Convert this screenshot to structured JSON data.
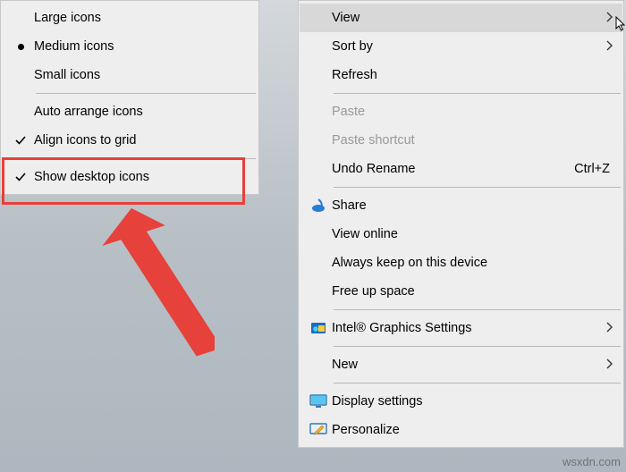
{
  "left_menu": {
    "items": [
      {
        "label": "Large icons",
        "marker": ""
      },
      {
        "label": "Medium icons",
        "marker": "bullet"
      },
      {
        "label": "Small icons",
        "marker": ""
      }
    ],
    "arrange": [
      {
        "label": "Auto arrange icons",
        "marker": ""
      },
      {
        "label": "Align icons to grid",
        "marker": "check"
      }
    ],
    "showDesktop": {
      "label": "Show desktop icons",
      "marker": "check"
    }
  },
  "right_menu": {
    "top": [
      {
        "label": "View",
        "submenu": true,
        "hover": true
      },
      {
        "label": "Sort by",
        "submenu": true
      },
      {
        "label": "Refresh"
      }
    ],
    "paste": [
      {
        "label": "Paste",
        "disabled": true
      },
      {
        "label": "Paste shortcut",
        "disabled": true
      },
      {
        "label": "Undo Rename",
        "shortcut": "Ctrl+Z"
      }
    ],
    "share": [
      {
        "label": "Share",
        "icon": "share"
      },
      {
        "label": "View online"
      },
      {
        "label": "Always keep on this device"
      },
      {
        "label": "Free up space"
      }
    ],
    "intel": [
      {
        "label": "Intel® Graphics Settings",
        "icon": "intel",
        "submenu": true
      }
    ],
    "new": [
      {
        "label": "New",
        "submenu": true
      }
    ],
    "settings": [
      {
        "label": "Display settings",
        "icon": "monitor"
      },
      {
        "label": "Personalize",
        "icon": "personalize"
      }
    ]
  },
  "watermark": "wsxdn.com"
}
